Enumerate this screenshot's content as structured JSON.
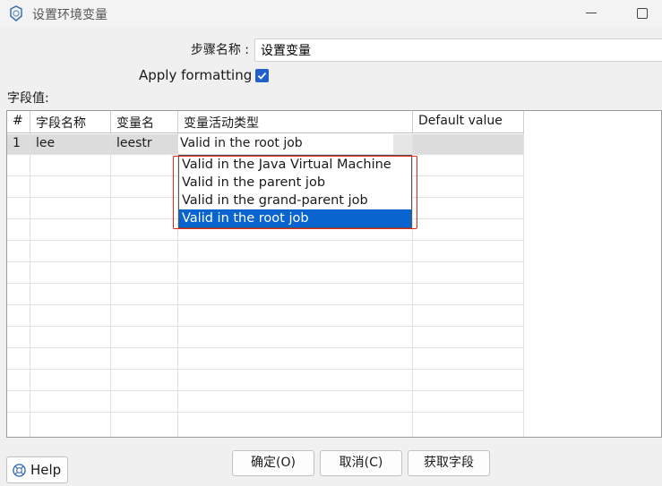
{
  "window": {
    "title": "设置环境变量"
  },
  "step": {
    "label": "步骤名称 :",
    "value": "设置变量"
  },
  "formatting": {
    "label": "Apply formatting",
    "checked": true
  },
  "fields": {
    "label": "字段值:",
    "columns": [
      "#",
      "字段名称",
      "变量名",
      "变量活动类型",
      "Default value"
    ],
    "rows": [
      {
        "num": "1",
        "field": "lee",
        "variable": "leestr",
        "type": "Valid in the root job",
        "default": ""
      }
    ]
  },
  "dropdown": {
    "options": [
      "Valid in the Java Virtual Machine",
      "Valid in the parent job",
      "Valid in the grand-parent job",
      "Valid in the root job"
    ],
    "selected": "Valid in the root job"
  },
  "buttons": {
    "ok": "确定(O)",
    "cancel": "取消(C)",
    "get_fields": "获取字段",
    "help": "Help"
  },
  "colors": {
    "selection": "#0a64d0",
    "highlight_box": "#e0261b",
    "checkbox": "#2060c8"
  }
}
